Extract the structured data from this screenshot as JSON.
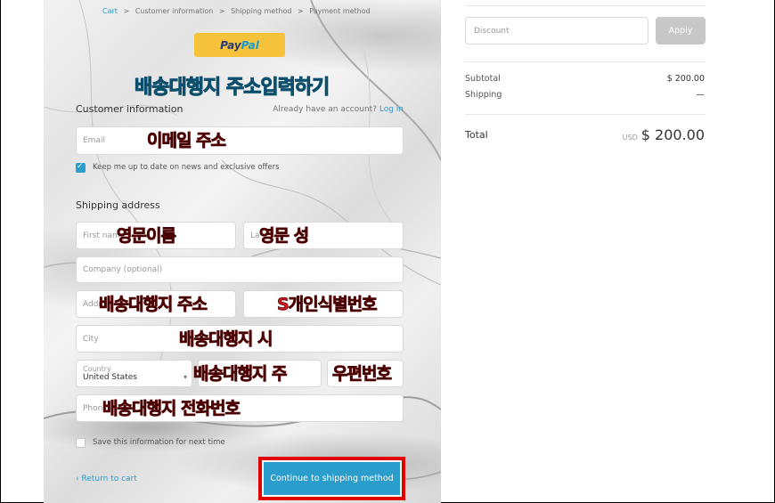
{
  "breadcrumb": [
    "Cart",
    ">",
    "Customer information",
    ">",
    "Shipping method",
    ">",
    "Payment method"
  ],
  "paypal": {
    "pay": "Pay",
    "pal": "Pal"
  },
  "annotations": {
    "title": "배송대행지 주소입력하기",
    "email": "이메일 주소",
    "first": "영문이름",
    "last": "영문 성",
    "address": "배송대행지 주소",
    "pcc": "S개인식별번호",
    "city": "배송대행지 시",
    "state": "배송대행지 주",
    "zip": "우편번호",
    "phone": "배송대행지 전화번호"
  },
  "customer": {
    "title": "Customer information",
    "account_q": "Already have an account?",
    "login": "Log in",
    "email_placeholder": "Email",
    "newsletter": "Keep me up to date on news and exclusive offers"
  },
  "shipping": {
    "title": "Shipping address",
    "first_placeholder": "First name",
    "last_placeholder": "La",
    "company_placeholder": "Company (optional)",
    "address_placeholder": "Addr",
    "city_placeholder": "City",
    "country_label": "Country",
    "country_value": "United States",
    "phone_placeholder": "Phon",
    "save_info": "Save this information for next time"
  },
  "footer": {
    "back": "‹ Return to cart",
    "continue": "Continue to shipping method"
  },
  "summary": {
    "discount_placeholder": "Discount",
    "apply": "Apply",
    "subtotal_label": "Subtotal",
    "subtotal_value": "$ 200.00",
    "shipping_label": "Shipping",
    "shipping_value": "—",
    "total_label": "Total",
    "currency": "USD",
    "total_value": "$ 200.00"
  },
  "colors": {
    "accent": "#2a9dcc",
    "annotation_red": "#d9121b",
    "annotation_blue": "#33aadd",
    "highlight": "#e00000"
  }
}
